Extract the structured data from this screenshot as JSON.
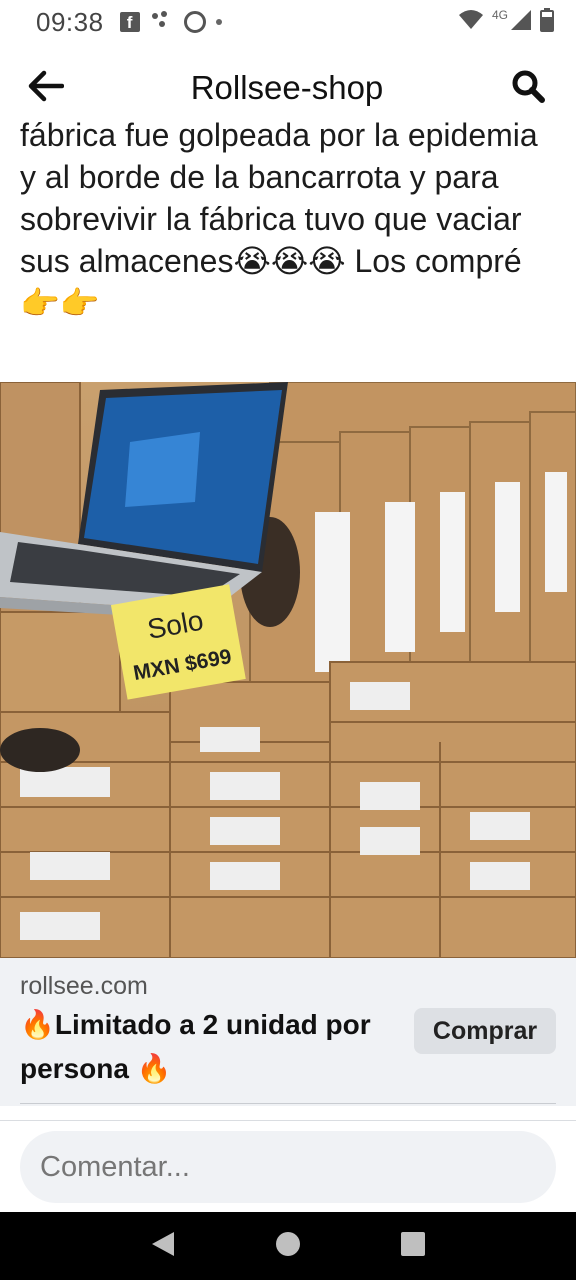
{
  "status_bar": {
    "time": "09:38",
    "network": "4G",
    "icons": [
      "facebook-icon",
      "dots-icon",
      "app-icon",
      "wifi-icon",
      "signal-icon",
      "battery-icon"
    ]
  },
  "header": {
    "back_icon": "arrow-left-icon",
    "title": "Rollsee-shop",
    "search_icon": "search-icon"
  },
  "post": {
    "text": "fábrica fue golpeada por la epidemia y al borde de la bancarrota y para sobrevivir la fábrica tuvo que vaciar sus almacenes😭😭😭 Los compré👉👉"
  },
  "photo": {
    "price_tag_line1": "Solo",
    "price_tag_line2": "MXN $699"
  },
  "link_card": {
    "domain": "rollsee.com",
    "headline": "🔥Limitado a 2 unidad por persona 🔥",
    "button_label": "Comprar"
  },
  "comment": {
    "placeholder": "Comentar..."
  },
  "colors": {
    "card_bg": "#f0f2f5",
    "button_bg": "#dde0e4",
    "navbar_bg": "#000000"
  }
}
